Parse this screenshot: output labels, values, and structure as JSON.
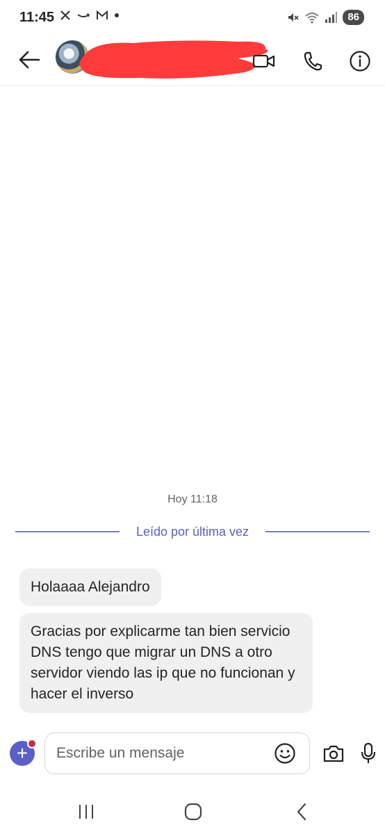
{
  "status_bar": {
    "time": "11:45",
    "left_icons": [
      "x-logo-icon",
      "amazon-icon",
      "gmail-icon",
      "dot-icon"
    ],
    "right_icons": [
      "mute-icon",
      "wifi-icon",
      "signal-icon"
    ],
    "battery": "86"
  },
  "header": {
    "back_icon": "arrow-left-icon",
    "avatar": "contact-avatar",
    "contact_name_redacted": true,
    "actions": [
      "video-call-icon",
      "phone-icon",
      "info-icon"
    ]
  },
  "conversation": {
    "timestamp": "Hoy 11:18",
    "last_read_label": "Leído por última vez",
    "messages": [
      {
        "text": "Holaaaa Alejandro"
      },
      {
        "text": "Gracias por explicarme tan bien servicio DNS tengo que migrar un DNS a otro servidor viendo las ip que no funcionan y hacer el inverso"
      }
    ]
  },
  "composer": {
    "placeholder": "Escribe un mensaje",
    "value": "",
    "icons": [
      "plus-icon",
      "emoji-icon",
      "camera-icon",
      "microphone-icon"
    ]
  },
  "navbar": {
    "icons": [
      "recents-icon",
      "home-icon",
      "back-icon"
    ]
  },
  "colors": {
    "accent": "#5b5fc7",
    "bubble": "#f0f0f0",
    "redaction": "#ff3b3b",
    "notification_dot": "#c4314b"
  }
}
